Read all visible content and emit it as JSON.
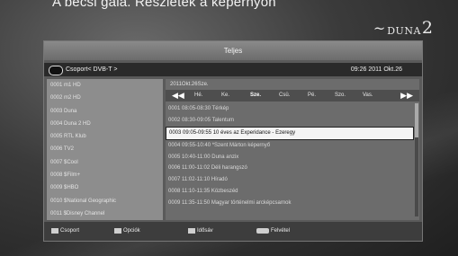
{
  "top_caption": "A bécsi gála. Részletek a képernyőn",
  "logo": {
    "name": "DUNA",
    "num": "2"
  },
  "panel": {
    "title": "Teljes",
    "group_label": "Csoport< DVB-T >",
    "clock": "09:26 2011 Okt.26"
  },
  "channels": [
    "0001 m1 HD",
    "0002 m2 HD",
    "0003 Duna",
    "0004 Duna 2 HD",
    "0005 RTL Klub",
    "0006 TV2",
    "0007 $Cool",
    "0008 $Film+",
    "0009 $HBO",
    "0010 $National Geographic",
    "0011 $Disney Channel"
  ],
  "epg": {
    "date": "2011Okt.26Sze.",
    "days": [
      "Hé.",
      "Ke.",
      "Sze.",
      "Csü.",
      "Pé.",
      "Szo.",
      "Vas."
    ],
    "active_day_index": 2,
    "events": [
      "0001 08:05-08:30 Térkép",
      "0002 08:30-09:05 Talentum",
      "0003 09:05-09:55 10 éves az Experidance - Ezeregy",
      "0004 09:55-10:40 *Szent Márton képernyő",
      "0005 10:40-11:00 Duna anzix",
      "0006 11:00-11:02 Déli harangszó",
      "0007 11:02-11:10 Híradó",
      "0008 11:10-11:35 Közbeszéd",
      "0009 11:35-11:50 Magyar történelmi arcképcsarnok"
    ],
    "selected_event_index": 2
  },
  "help": [
    {
      "key_label": "",
      "text": "Csoport"
    },
    {
      "key_label": "",
      "text": "Opciók"
    },
    {
      "key_label": "",
      "text": "Idősáv"
    },
    {
      "key_label": "",
      "text": "Felvétel"
    }
  ]
}
